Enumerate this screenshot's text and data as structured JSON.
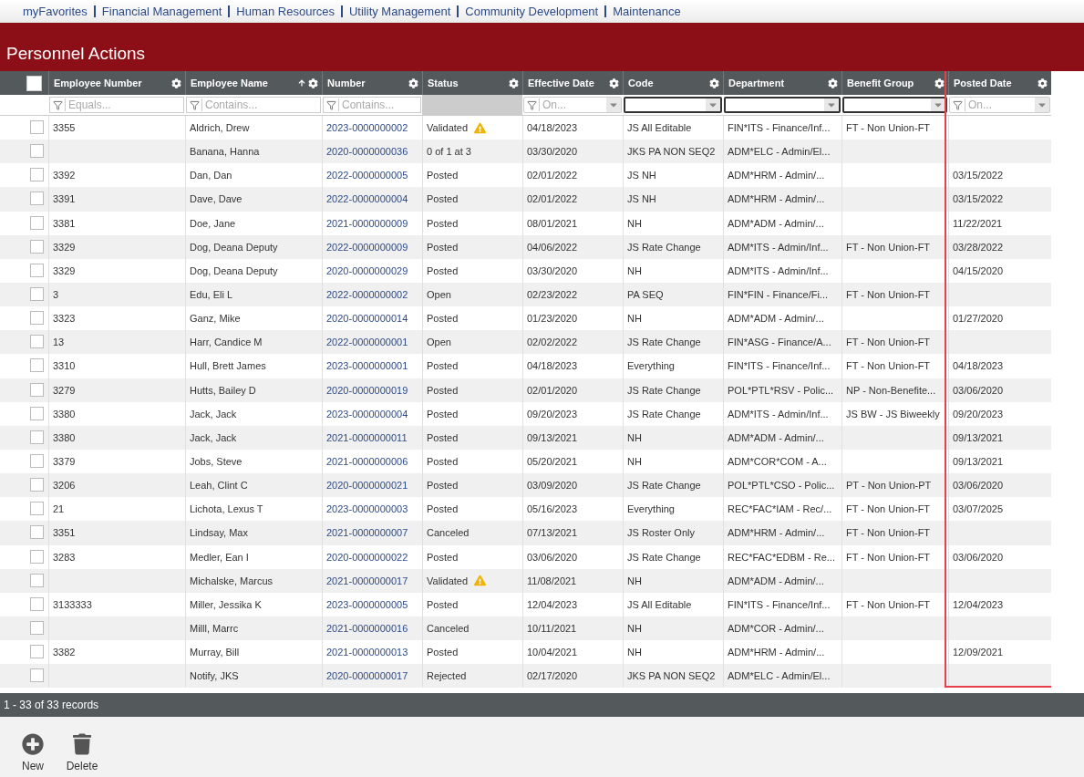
{
  "nav": {
    "links": [
      "myFavorites",
      "Financial Management",
      "Human Resources",
      "Utility Management",
      "Community Development",
      "Maintenance"
    ]
  },
  "page_title": "Personnel Actions",
  "grid": {
    "select_all": {
      "checked": false
    },
    "columns": [
      {
        "label": "Employee Number",
        "sorted": false,
        "highlighted": false,
        "filter": {
          "kind": "text",
          "placeholder": "Equals..."
        }
      },
      {
        "label": "Employee Name",
        "sorted": true,
        "highlighted": false,
        "filter": {
          "kind": "text",
          "placeholder": "Contains..."
        }
      },
      {
        "label": "Number",
        "sorted": false,
        "highlighted": false,
        "filter": {
          "kind": "text",
          "placeholder": "Contains..."
        }
      },
      {
        "label": "Status",
        "sorted": false,
        "highlighted": false,
        "filter": {
          "kind": "none"
        }
      },
      {
        "label": "Effective Date",
        "sorted": false,
        "highlighted": false,
        "filter": {
          "kind": "date",
          "placeholder": "On..."
        }
      },
      {
        "label": "Code",
        "sorted": false,
        "highlighted": false,
        "filter": {
          "kind": "select"
        }
      },
      {
        "label": "Department",
        "sorted": false,
        "highlighted": false,
        "filter": {
          "kind": "select"
        }
      },
      {
        "label": "Benefit Group",
        "sorted": false,
        "highlighted": false,
        "filter": {
          "kind": "select"
        }
      },
      {
        "label": "Posted Date",
        "sorted": false,
        "highlighted": true,
        "filter": {
          "kind": "date",
          "placeholder": "On..."
        }
      }
    ],
    "rows": [
      {
        "selected": false,
        "warning": true,
        "employee_number": "3355",
        "name": "Aldrich, Drew",
        "number": "2023-0000000002",
        "status": "Validated",
        "effective": "04/18/2023",
        "code": "JS All Editable",
        "department": "FIN*ITS - Finance/Inf...",
        "benefit": "FT - Non Union-FT"
      },
      {
        "selected": false,
        "warning": false,
        "name": "Banana, Hanna",
        "number": "2020-0000000036",
        "status": "0 of 1 at 3",
        "effective": "03/30/2020",
        "code": "JKS PA NON SEQ2",
        "department": "ADM*ELC - Admin/El..."
      },
      {
        "selected": false,
        "warning": false,
        "employee_number": "3392",
        "name": "Dan, Dan",
        "number": "2022-0000000005",
        "status": "Posted",
        "effective": "02/01/2022",
        "code": "JS NH",
        "department": "ADM*HRM - Admin/...",
        "posted": "03/15/2022"
      },
      {
        "selected": false,
        "warning": false,
        "employee_number": "3391",
        "name": "Dave, Dave",
        "number": "2022-0000000004",
        "status": "Posted",
        "effective": "02/01/2022",
        "code": "JS NH",
        "department": "ADM*HRM - Admin/...",
        "posted": "03/15/2022"
      },
      {
        "selected": false,
        "warning": false,
        "employee_number": "3381",
        "name": "Doe, Jane",
        "number": "2021-0000000009",
        "status": "Posted",
        "effective": "08/01/2021",
        "code": "NH",
        "department": "ADM*ADM - Admin/...",
        "posted": "11/22/2021"
      },
      {
        "selected": false,
        "warning": false,
        "employee_number": "3329",
        "name": "Dog, Deana Deputy",
        "number": "2022-0000000009",
        "status": "Posted",
        "effective": "04/06/2022",
        "code": "JS Rate Change",
        "department": "ADM*ITS - Admin/Inf...",
        "benefit": "FT - Non Union-FT",
        "posted": "03/28/2022"
      },
      {
        "selected": false,
        "warning": false,
        "employee_number": "3329",
        "name": "Dog, Deana Deputy",
        "number": "2020-0000000029",
        "status": "Posted",
        "effective": "03/30/2020",
        "code": "NH",
        "department": "ADM*ITS - Admin/Inf...",
        "posted": "04/15/2020"
      },
      {
        "selected": false,
        "warning": false,
        "employee_number": "3",
        "name": "Edu, Eli L",
        "number": "2022-0000000002",
        "status": "Open",
        "effective": "02/23/2022",
        "code": "PA SEQ",
        "department": "FIN*FIN - Finance/Fi...",
        "benefit": "FT - Non Union-FT"
      },
      {
        "selected": false,
        "warning": false,
        "employee_number": "3323",
        "name": "Ganz, Mike",
        "number": "2020-0000000014",
        "status": "Posted",
        "effective": "01/23/2020",
        "code": "NH",
        "department": "ADM*ADM - Admin/...",
        "posted": "01/27/2020"
      },
      {
        "selected": false,
        "warning": false,
        "employee_number": "13",
        "name": "Harr, Candice M",
        "number": "2022-0000000001",
        "status": "Open",
        "effective": "02/02/2022",
        "code": "JS Rate Change",
        "department": "FIN*ASG - Finance/A...",
        "benefit": "FT - Non Union-FT"
      },
      {
        "selected": false,
        "warning": false,
        "employee_number": "3310",
        "name": "Hull, Brett James",
        "number": "2023-0000000001",
        "status": "Posted",
        "effective": "04/18/2023",
        "code": "Everything",
        "department": "FIN*ITS - Finance/Inf...",
        "benefit": "FT - Non Union-FT",
        "posted": "04/18/2023"
      },
      {
        "selected": false,
        "warning": false,
        "employee_number": "3279",
        "name": "Hutts, Bailey D",
        "number": "2020-0000000019",
        "status": "Posted",
        "effective": "02/01/2020",
        "code": "JS Rate Change",
        "department": "POL*PTL*RSV - Polic...",
        "benefit": "NP - Non-Benefite...",
        "posted": "03/06/2020"
      },
      {
        "selected": false,
        "warning": false,
        "employee_number": "3380",
        "name": "Jack, Jack",
        "number": "2023-0000000004",
        "status": "Posted",
        "effective": "09/20/2023",
        "code": "JS Rate Change",
        "department": "ADM*ITS - Admin/Inf...",
        "benefit": "JS BW - JS Biweekly",
        "posted": "09/20/2023"
      },
      {
        "selected": false,
        "warning": false,
        "employee_number": "3380",
        "name": "Jack, Jack",
        "number": "2021-0000000011",
        "status": "Posted",
        "effective": "09/13/2021",
        "code": "NH",
        "department": "ADM*ADM - Admin/...",
        "posted": "09/13/2021"
      },
      {
        "selected": false,
        "warning": false,
        "employee_number": "3379",
        "name": "Jobs, Steve",
        "number": "2021-0000000006",
        "status": "Posted",
        "effective": "05/20/2021",
        "code": "NH",
        "department": "ADM*COR*COM - A...",
        "posted": "09/13/2021"
      },
      {
        "selected": false,
        "warning": false,
        "employee_number": "3206",
        "name": "Leah, Clint C",
        "number": "2020-0000000021",
        "status": "Posted",
        "effective": "03/09/2020",
        "code": "JS Rate Change",
        "department": "POL*PTL*CSO - Polic...",
        "benefit": "PT - Non Union-PT",
        "posted": "03/06/2020"
      },
      {
        "selected": false,
        "warning": false,
        "employee_number": "21",
        "name": "Lichota, Lexus T",
        "number": "2023-0000000003",
        "status": "Posted",
        "effective": "05/16/2023",
        "code": "Everything",
        "department": "REC*FAC*IAM - Rec/...",
        "benefit": "FT - Non Union-FT",
        "posted": "03/07/2025"
      },
      {
        "selected": false,
        "warning": false,
        "employee_number": "3351",
        "name": "Lindsay, Max",
        "number": "2021-0000000007",
        "status": "Canceled",
        "effective": "07/13/2021",
        "code": "JS Roster Only",
        "department": "ADM*HRM - Admin/...",
        "benefit": "FT - Non Union-FT"
      },
      {
        "selected": false,
        "warning": false,
        "employee_number": "3283",
        "name": "Medler, Ean I",
        "number": "2020-0000000022",
        "status": "Posted",
        "effective": "03/06/2020",
        "code": "JS Rate Change",
        "department": "REC*FAC*EDBM - Re...",
        "benefit": "FT - Non Union-FT",
        "posted": "03/06/2020"
      },
      {
        "selected": false,
        "warning": true,
        "name": "Michalske, Marcus",
        "number": "2021-0000000017",
        "status": "Validated",
        "effective": "11/08/2021",
        "code": "NH",
        "department": "ADM*ADM - Admin/..."
      },
      {
        "selected": false,
        "warning": false,
        "employee_number": "3133333",
        "name": "Miller, Jessika K",
        "number": "2023-0000000005",
        "status": "Posted",
        "effective": "12/04/2023",
        "code": "JS All Editable",
        "department": "FIN*ITS - Finance/Inf...",
        "benefit": "FT - Non Union-FT",
        "posted": "12/04/2023"
      },
      {
        "selected": false,
        "warning": false,
        "name": "Milll, Marrc",
        "number": "2021-0000000016",
        "status": "Canceled",
        "effective": "10/11/2021",
        "code": "NH",
        "department": "ADM*COR - Admin/..."
      },
      {
        "selected": false,
        "warning": false,
        "employee_number": "3382",
        "name": "Murray, Bill",
        "number": "2021-0000000013",
        "status": "Posted",
        "effective": "10/04/2021",
        "code": "NH",
        "department": "ADM*HRM - Admin/...",
        "posted": "12/09/2021"
      },
      {
        "selected": false,
        "warning": false,
        "name": "Notify, JKS",
        "number": "2020-0000000017",
        "status": "Rejected",
        "effective": "02/17/2020",
        "code": "JKS PA NON SEQ2",
        "department": "ADM*ELC - Admin/El..."
      }
    ],
    "record_count": "1 - 33 of 33 records"
  },
  "toolbar": [
    {
      "kind": "new",
      "label": "New"
    },
    {
      "kind": "delete",
      "label": "Delete"
    }
  ]
}
